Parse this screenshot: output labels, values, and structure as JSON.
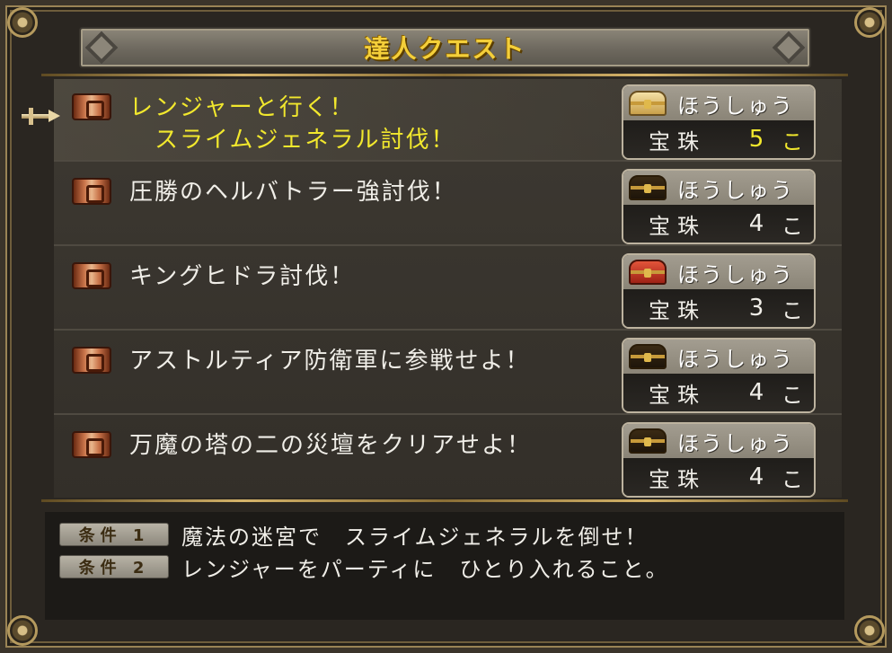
{
  "window": {
    "title": "達人クエスト"
  },
  "quests": [
    {
      "name": "レンジャーと行く！\n　スライムジェネラル討伐！",
      "selected": true,
      "reward": {
        "header": "ほうしゅう",
        "chest": "gold-chest-icon",
        "item": "宝珠",
        "count": "5",
        "unit": "こ"
      }
    },
    {
      "name": "圧勝のヘルバトラー強討伐！",
      "selected": false,
      "reward": {
        "header": "ほうしゅう",
        "chest": "dark-chest-icon",
        "item": "宝珠",
        "count": "4",
        "unit": "こ"
      }
    },
    {
      "name": "キングヒドラ討伐！",
      "selected": false,
      "reward": {
        "header": "ほうしゅう",
        "chest": "red-chest-icon",
        "item": "宝珠",
        "count": "3",
        "unit": "こ"
      }
    },
    {
      "name": "アストルティア防衛軍に参戦せよ！",
      "selected": false,
      "reward": {
        "header": "ほうしゅう",
        "chest": "dark-chest-icon",
        "item": "宝珠",
        "count": "4",
        "unit": "こ"
      }
    },
    {
      "name": "万魔の塔の二の災壇をクリアせよ！",
      "selected": false,
      "reward": {
        "header": "ほうしゅう",
        "chest": "dark-chest-icon",
        "item": "宝珠",
        "count": "4",
        "unit": "こ"
      }
    }
  ],
  "conditions": [
    {
      "label": "条件 1",
      "text": "魔法の迷宮で　スライムジェネラルを倒せ！"
    },
    {
      "label": "条件 2",
      "text": "レンジャーをパーティに　ひとり入れること。"
    }
  ],
  "colors": {
    "accent_title": "#f4cf3a",
    "selected_text": "#f2e82d",
    "normal_text": "#f0eee8",
    "panel_bg": "#3d3932"
  }
}
